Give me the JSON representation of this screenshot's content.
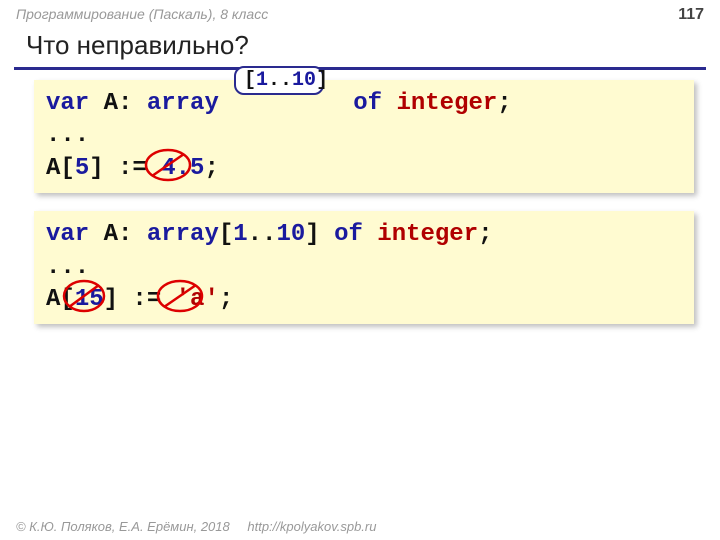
{
  "header": {
    "course": "Программирование (Паскаль), 8 класс",
    "page": "117"
  },
  "title": "Что неправильно?",
  "callout": {
    "open": "[",
    "range_a": "1",
    "dots": "..",
    "range_b": "10",
    "close": "]"
  },
  "block1": {
    "kw_var": "var",
    "id_A": " A: ",
    "kw_array": "array",
    "bracket_content": "",
    "kw_of": " of ",
    "type_int": "integer",
    "semi": ";",
    "ellipsis": "...",
    "line3_pre": "A[",
    "idx": "5",
    "line3_mid": "] := ",
    "val": "4.5",
    "line3_end": ";"
  },
  "block2": {
    "kw_var": "var",
    "id_A": " A: ",
    "kw_array": "array",
    "br_open": "[",
    "lo": "1",
    "dots": "..",
    "hi": "10",
    "br_close": "]",
    "kw_of": " of ",
    "type_int": "integer",
    "semi": ";",
    "ellipsis": "...",
    "line3_pre": "A[",
    "idx": "15",
    "line3_mid": "] := ",
    "val": "'a'",
    "line3_end": ";"
  },
  "footer": {
    "copyright": "© К.Ю. Поляков, Е.А. Ерёмин, 2018",
    "url": "http://kpolyakov.spb.ru"
  }
}
